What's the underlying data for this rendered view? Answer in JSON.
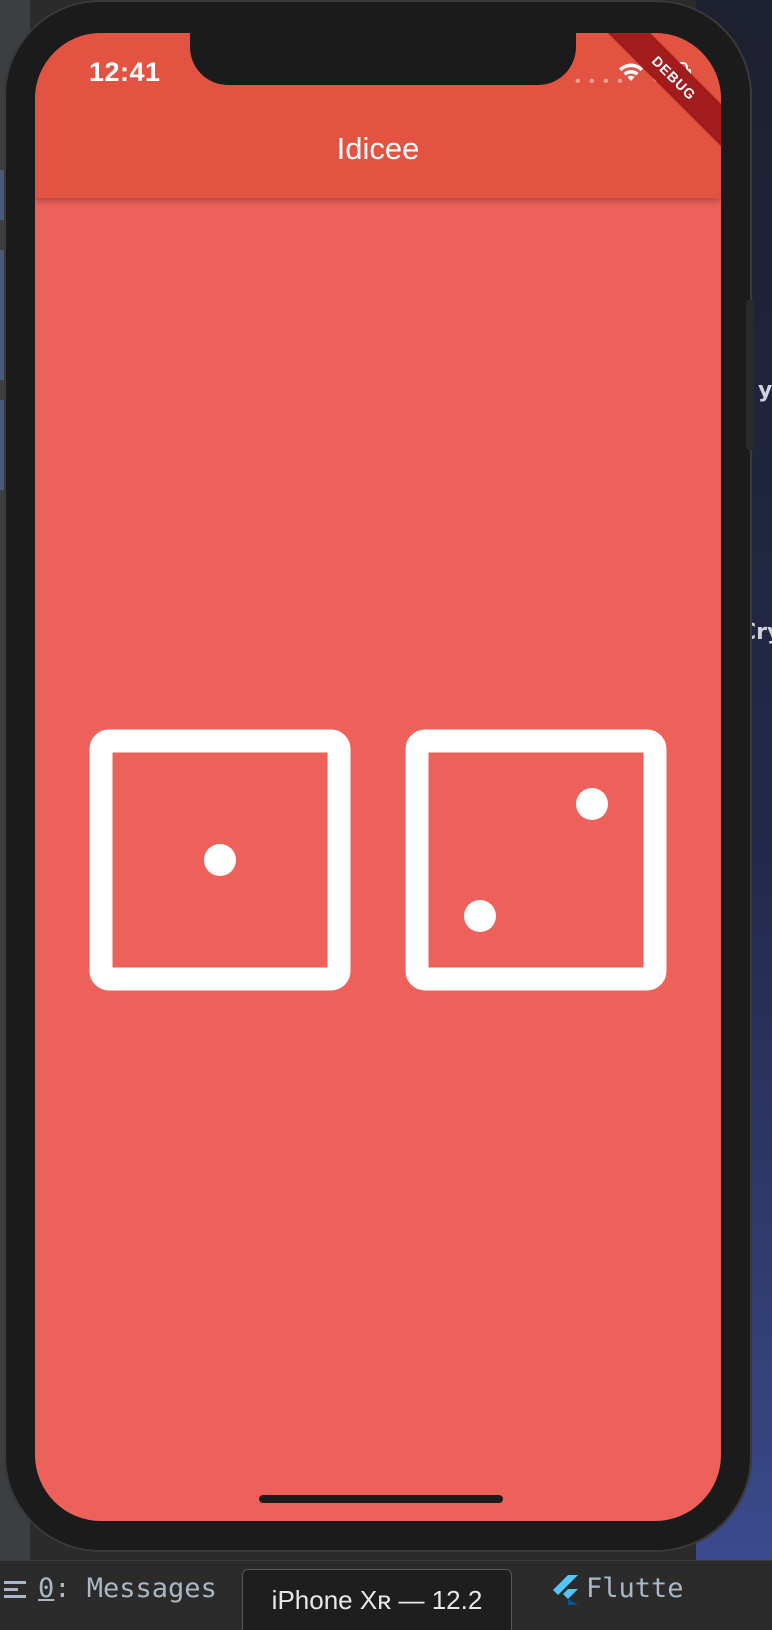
{
  "status_bar": {
    "time": "12:41"
  },
  "app_bar": {
    "title": "Idicee",
    "debug_banner": "DEBUG"
  },
  "colors": {
    "background": "#ee605a",
    "app_bar": "#e35342",
    "dice": "#ffffff"
  },
  "dice": [
    {
      "value": 1
    },
    {
      "value": 2
    }
  ],
  "ide": {
    "messages_tab": {
      "number": "0",
      "label": ": Messages"
    },
    "device_tab": "iPhone Xʀ — 12.2",
    "flutter_tab": "Flutte"
  },
  "icons": [
    "wifi-icon",
    "battery-icon",
    "messages-icon",
    "flutter-icon"
  ]
}
